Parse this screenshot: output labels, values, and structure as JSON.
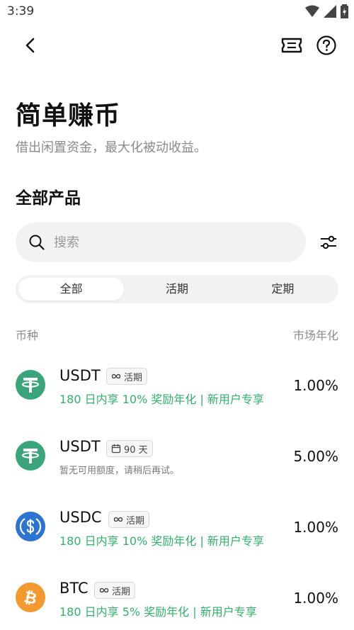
{
  "status": {
    "time": "3:39"
  },
  "header": {
    "title": "简单赚币",
    "subtitle": "借出闲置资金，最大化被动收益。"
  },
  "section": {
    "title": "全部产品"
  },
  "search": {
    "placeholder": "搜索"
  },
  "tabs": [
    {
      "label": "全部",
      "active": true
    },
    {
      "label": "活期",
      "active": false
    },
    {
      "label": "定期",
      "active": false
    }
  ],
  "columns": {
    "left": "币种",
    "right": "市场年化"
  },
  "products": [
    {
      "coin": "USDT",
      "icon": "tether-icon",
      "color": "#3aa57a",
      "badge": "活期",
      "badge_icon": "infinity-icon",
      "promo": "180 日内享 10% 奖励年化 | 新用户专享",
      "note": "",
      "rate": "1.00%"
    },
    {
      "coin": "USDT",
      "icon": "tether-icon",
      "color": "#3aa57a",
      "badge": "90 天",
      "badge_icon": "calendar-icon",
      "promo": "",
      "note": "暂无可用额度，请稍后再试。",
      "rate": "5.00%"
    },
    {
      "coin": "USDC",
      "icon": "usdc-icon",
      "color": "#2b74d0",
      "badge": "活期",
      "badge_icon": "infinity-icon",
      "promo": "180 日内享 10% 奖励年化 | 新用户专享",
      "note": "",
      "rate": "1.00%"
    },
    {
      "coin": "BTC",
      "icon": "bitcoin-icon",
      "color": "#f39a2e",
      "badge": "活期",
      "badge_icon": "infinity-icon",
      "promo": "180 日内享 5% 奖励年化 | 新用户专享",
      "note": "",
      "rate": "1.00%"
    }
  ],
  "colors": {
    "accent_green": "#2fb36a",
    "muted": "#8a8a8a"
  }
}
